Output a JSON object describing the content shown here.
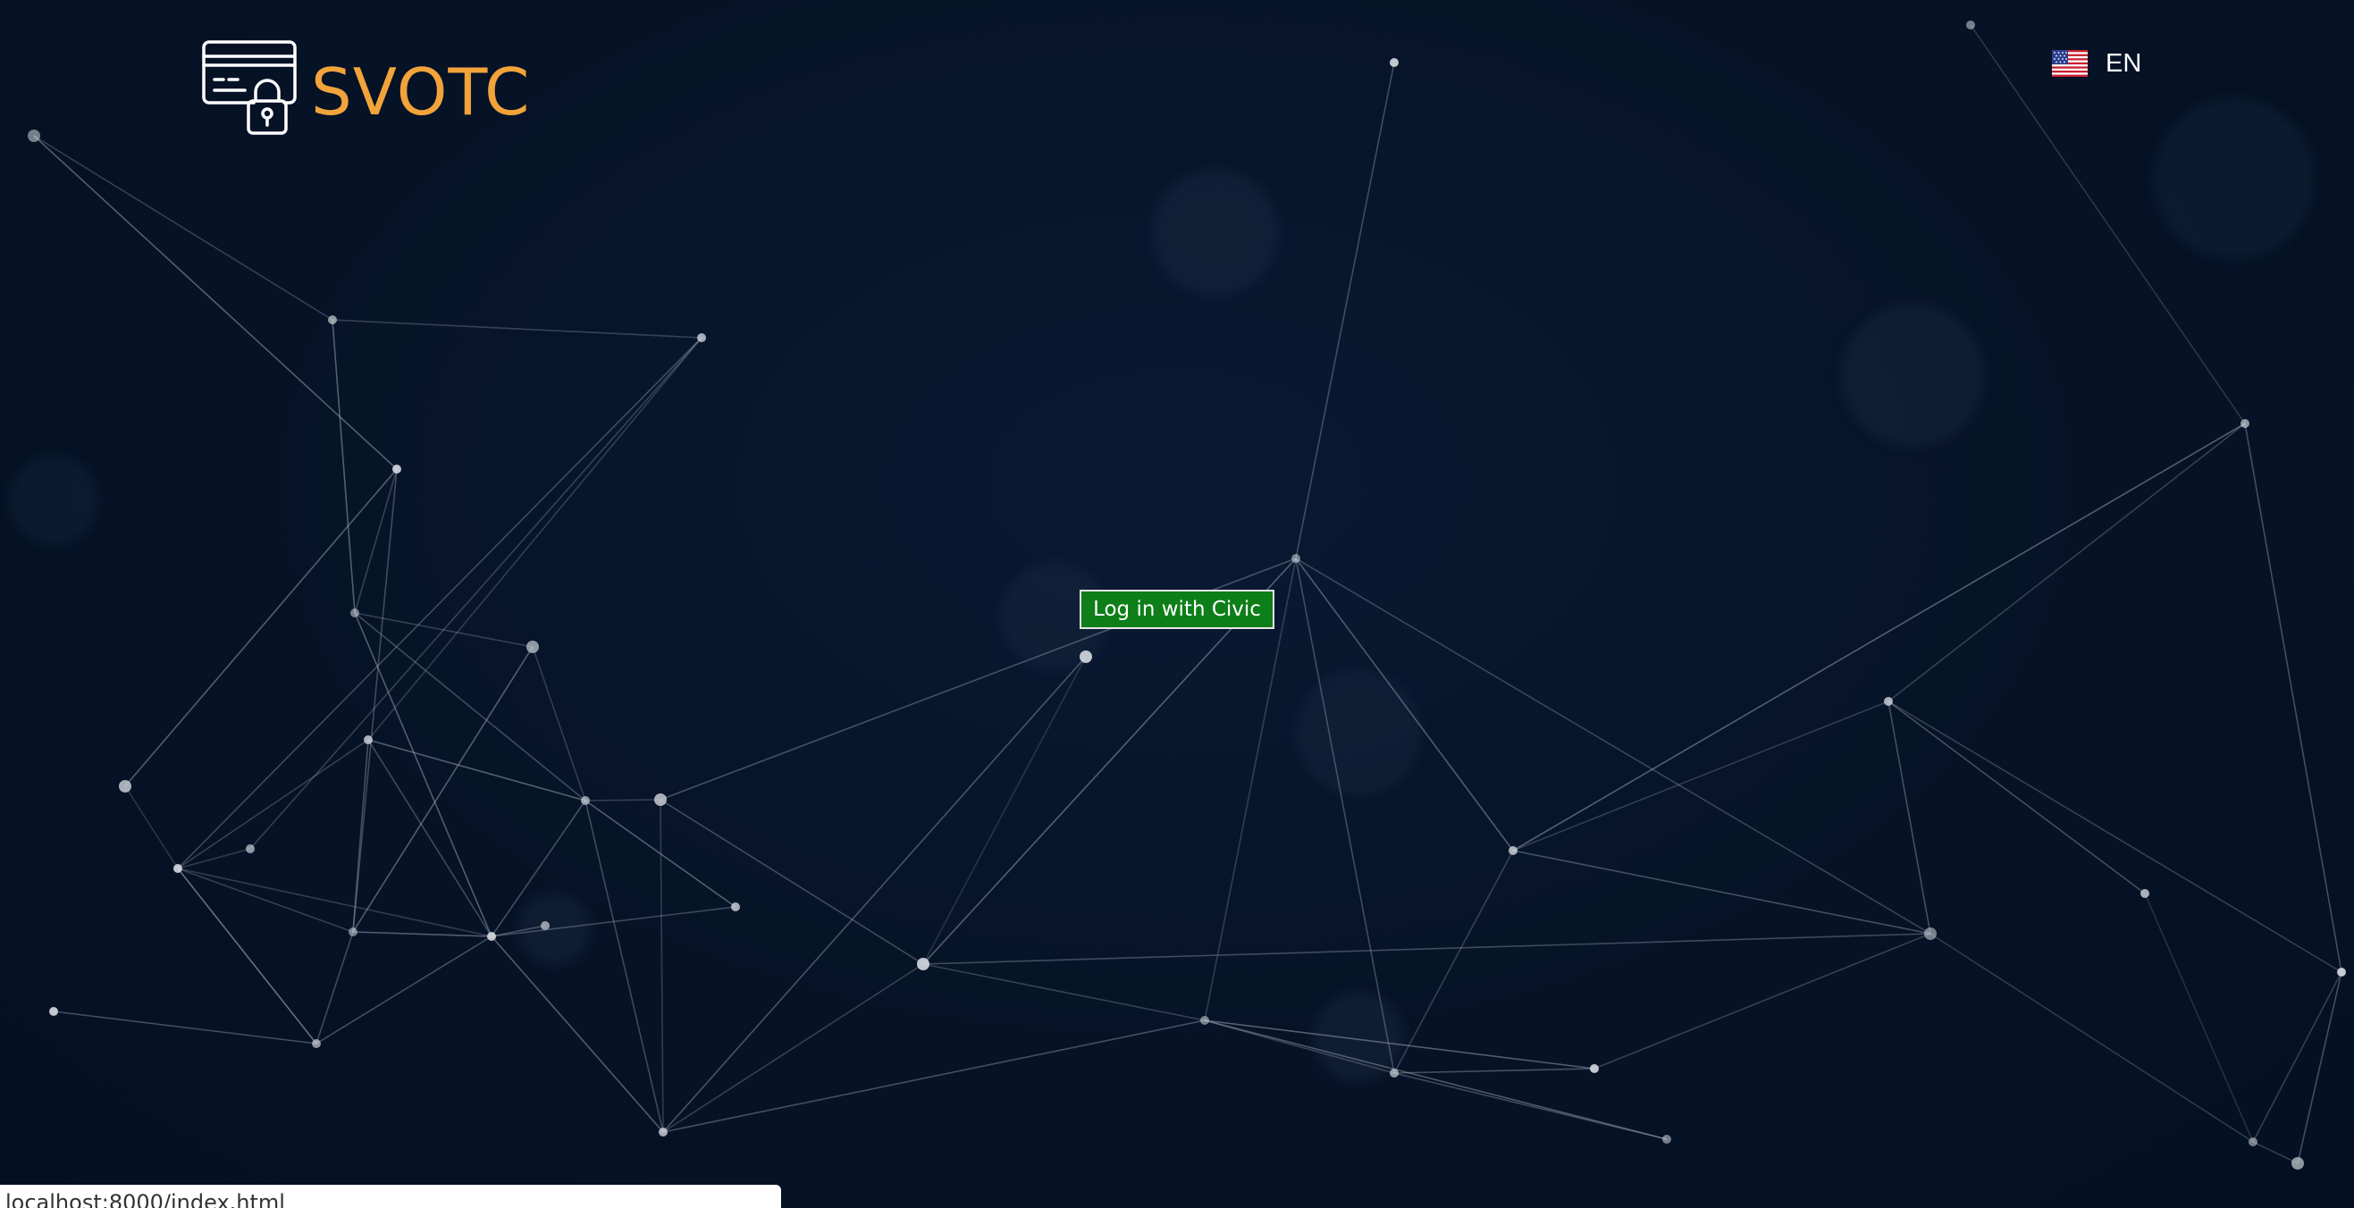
{
  "brand": {
    "name": "SVOTC",
    "logo_icon": "card-lock-icon",
    "accent_color": "#f2a33a"
  },
  "language": {
    "flag_icon": "us-flag-icon",
    "label": "EN"
  },
  "login": {
    "label": "Log in with Civic",
    "button_color": "#0e7e18"
  },
  "status_bar": {
    "url": "localhost:8000/index.html"
  },
  "background": {
    "decoration": "network-graph",
    "color": "#061327"
  }
}
